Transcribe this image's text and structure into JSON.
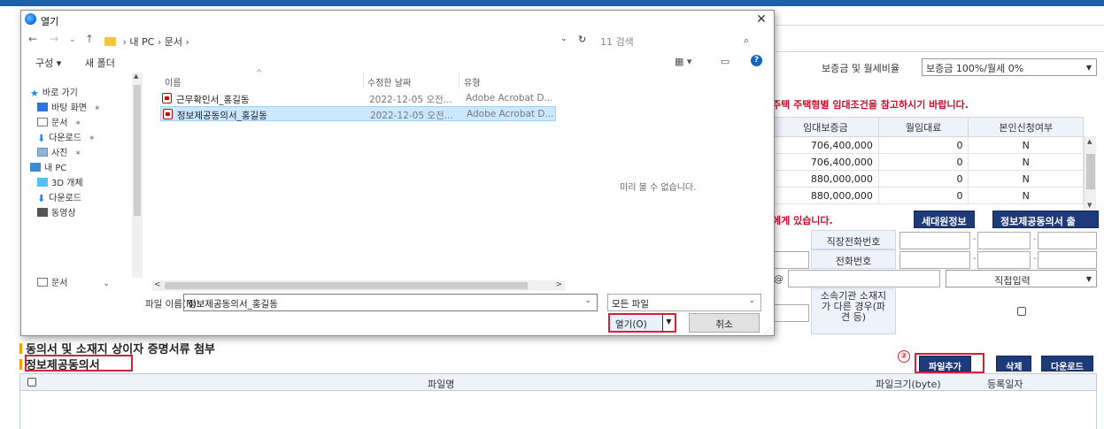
{
  "background": {
    "deposit_label": "보증금 및 월세비율",
    "deposit_select_value": "보증금 100%/월세 0%",
    "notice_ref": "주택 주택형별 임대조건을 참고하시기 바랍니다.",
    "rent_table": {
      "headers": [
        "임대보증금",
        "월임대료",
        "본인신청여부"
      ],
      "rows": [
        [
          "706,400,000",
          "0",
          "N"
        ],
        [
          "706,400,000",
          "0",
          "N"
        ],
        [
          "880,000,000",
          "0",
          "N"
        ],
        [
          "880,000,000",
          "0",
          "N"
        ]
      ]
    },
    "notice_have": "에게 있습니다.",
    "household_btn": "세대원정보",
    "consent_btn": "정보제공동의서 출",
    "work_phone_label": "직장전화번호",
    "phone_label": "전화번호",
    "at_sign": "@",
    "email_domain_select": "직접입력",
    "agency_address_label": "소속기관 소재지가 다른 경우(파견 등)",
    "section_title_main": "동의서 및 소재지 상이자 증명서류 첨부",
    "section_title_sub": "정보제공동의서",
    "step_marker": "②",
    "add_file_btn": "파일추가",
    "delete_btn": "삭제",
    "download_btn": "다운로드",
    "file_table_headers": {
      "name": "파일명",
      "size": "파일크기(byte)",
      "date": "등록일자"
    }
  },
  "dialog": {
    "title": "열기",
    "breadcrumb": [
      "내 PC",
      "문서"
    ],
    "search_placeholder": "11 검색",
    "toolbar": {
      "organize": "구성 ▾",
      "new_folder": "새 폴더"
    },
    "nav": [
      {
        "label": "바로 가기",
        "icon": "star-icon"
      },
      {
        "label": "바탕 화면",
        "icon": "desktop-icon",
        "pinned": true
      },
      {
        "label": "문서",
        "icon": "documents-icon",
        "pinned": true
      },
      {
        "label": "다운로드",
        "icon": "download-icon",
        "pinned": true
      },
      {
        "label": "사진",
        "icon": "pictures-icon",
        "pinned": true
      },
      {
        "label": "내 PC",
        "icon": "pc-icon"
      },
      {
        "label": "3D 개체",
        "icon": "3d-objects-icon"
      },
      {
        "label": "다운로드",
        "icon": "download-icon"
      },
      {
        "label": "동영상",
        "icon": "videos-icon"
      }
    ],
    "nav_bottom": "문서",
    "columns": {
      "name": "이름",
      "modified": "수정한 날짜",
      "type": "유형"
    },
    "files": [
      {
        "name": "근무확인서_홍길동",
        "modified": "2022-12-05 오전...",
        "type": "Adobe Acrobat D...",
        "selected": false
      },
      {
        "name": "정보제공동의서_홍길동",
        "modified": "2022-12-05 오전...",
        "type": "Adobe Acrobat D...",
        "selected": true
      }
    ],
    "preview_message": "미리 볼 수 없습니다.",
    "filename_label": "파일 이름(N):",
    "filename_value": "정보제공동의서_홍길동",
    "filetype_value": "모든 파일",
    "open_btn": "열기(O)",
    "cancel_btn": "취소"
  },
  "colors": {
    "accent_red": "#d0203a",
    "navy": "#1e3a78",
    "header_blue": "#1f5fa8",
    "selection": "#cce8ff"
  }
}
